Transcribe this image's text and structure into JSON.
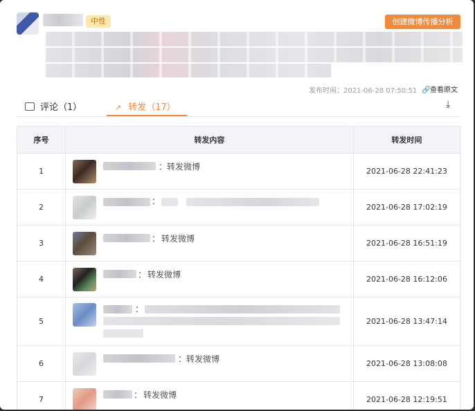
{
  "post": {
    "sentiment_badge": "中性",
    "create_button": "创建微博传播分析",
    "published_label": "发布时间：",
    "published_time": "2021-06-28 07:50:51",
    "view_original": "查看原文"
  },
  "tabs": {
    "comment_label": "评论（1）",
    "repost_label": "转发（17）",
    "active": "repost"
  },
  "table": {
    "headers": [
      "序号",
      "转发内容",
      "转发时间"
    ],
    "rows": [
      {
        "index": "1",
        "text": "转发微博",
        "time": "2021-06-28 22:41:23"
      },
      {
        "index": "2",
        "text": "",
        "time": "2021-06-28 17:02:19"
      },
      {
        "index": "3",
        "text": "转发微博",
        "time": "2021-06-28 16:51:19"
      },
      {
        "index": "4",
        "text": "转发微博",
        "time": "2021-06-28 16:12:06"
      },
      {
        "index": "5",
        "text": "",
        "time": "2021-06-28 13:47:14"
      },
      {
        "index": "6",
        "text": "转发微博",
        "time": "2021-06-28 13:08:08"
      },
      {
        "index": "7",
        "text": "转发微博",
        "time": "2021-06-28 12:19:51"
      }
    ]
  },
  "colors": {
    "accent": "#f08a3c",
    "badge_bg": "#fce8b0"
  }
}
